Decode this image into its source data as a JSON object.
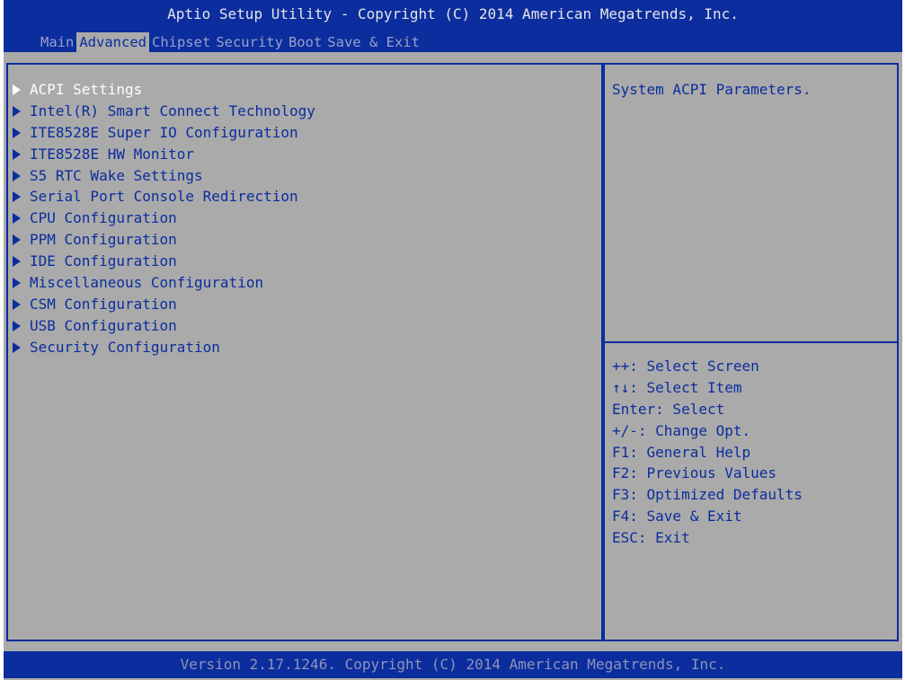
{
  "header": {
    "title": "Aptio Setup Utility - Copyright (C) 2014 American Megatrends, Inc.",
    "tabs": [
      {
        "label": "Main"
      },
      {
        "label": "Advanced"
      },
      {
        "label": "Chipset"
      },
      {
        "label": "Security"
      },
      {
        "label": "Boot"
      },
      {
        "label": "Save & Exit"
      }
    ],
    "active_tab": "Advanced"
  },
  "menu": {
    "selected_item": "ACPI Settings",
    "items": [
      {
        "label": "ACPI Settings",
        "icon": "submenu-arrow-icon"
      },
      {
        "label": "Intel(R) Smart Connect Technology",
        "icon": "submenu-arrow-icon"
      },
      {
        "label": "ITE8528E Super IO Configuration",
        "icon": "submenu-arrow-icon"
      },
      {
        "label": "ITE8528E HW Monitor",
        "icon": "submenu-arrow-icon"
      },
      {
        "label": "S5 RTC Wake Settings",
        "icon": "submenu-arrow-icon"
      },
      {
        "label": "Serial Port Console Redirection",
        "icon": "submenu-arrow-icon"
      },
      {
        "label": "CPU Configuration",
        "icon": "submenu-arrow-icon"
      },
      {
        "label": "PPM Configuration",
        "icon": "submenu-arrow-icon"
      },
      {
        "label": "IDE Configuration",
        "icon": "submenu-arrow-icon"
      },
      {
        "label": "Miscellaneous Configuration",
        "icon": "submenu-arrow-icon"
      },
      {
        "label": "CSM Configuration",
        "icon": "submenu-arrow-icon"
      },
      {
        "label": "USB Configuration",
        "icon": "submenu-arrow-icon"
      },
      {
        "label": "Security Configuration",
        "icon": "submenu-arrow-icon"
      }
    ]
  },
  "help": {
    "description": "System ACPI Parameters.",
    "keys": [
      "++: Select Screen",
      "↑↓: Select Item",
      "Enter: Select",
      "+/-: Change Opt.",
      "F1: General Help",
      "F2: Previous Values",
      "F3: Optimized Defaults",
      "F4: Save & Exit",
      "ESC: Exit"
    ]
  },
  "footer": {
    "text": "Version 2.17.1246. Copyright (C) 2014 American Megatrends, Inc."
  },
  "colors": {
    "background": "#aaaaaa",
    "bar_blue": "#0b2d9e",
    "text_blue": "#0b2d9e",
    "selected_text": "#ffffff",
    "inactive_tab_text": "#9aa0c8"
  }
}
